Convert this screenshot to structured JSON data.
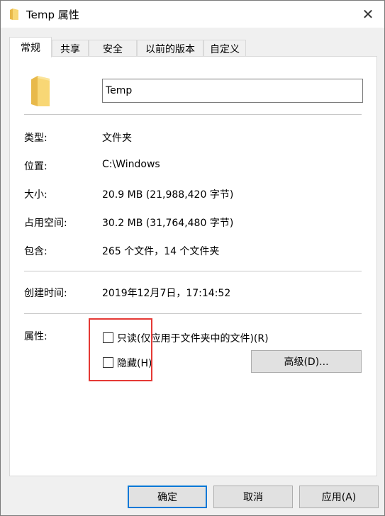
{
  "window": {
    "title": "Temp 属性",
    "close_glyph": "✕"
  },
  "tabs": [
    {
      "label": "常规",
      "active": true
    },
    {
      "label": "共享"
    },
    {
      "label": "安全"
    },
    {
      "label": "以前的版本"
    },
    {
      "label": "自定义"
    }
  ],
  "general": {
    "name_value": "Temp",
    "type_label": "类型:",
    "type_value": "文件夹",
    "location_label": "位置:",
    "location_value": "C:\\Windows",
    "size_label": "大小:",
    "size_value": "20.9 MB (21,988,420 字节)",
    "disk_label": "占用空间:",
    "disk_value": "30.2 MB (31,764,480 字节)",
    "contains_label": "包含:",
    "contains_value": "265 个文件，14 个文件夹",
    "created_label": "创建时间:",
    "created_value": "2019年12月7日，17:14:52",
    "attributes_label": "属性:",
    "readonly_label": "只读(仅应用于文件夹中的文件)(R)",
    "hidden_label": "隐藏(H)",
    "advanced_label": "高级(D)..."
  },
  "buttons": {
    "ok": "确定",
    "cancel": "取消",
    "apply": "应用(A)"
  },
  "colors": {
    "accent": "#0078d7",
    "highlight": "#e53935",
    "folder": "#f8d775"
  }
}
